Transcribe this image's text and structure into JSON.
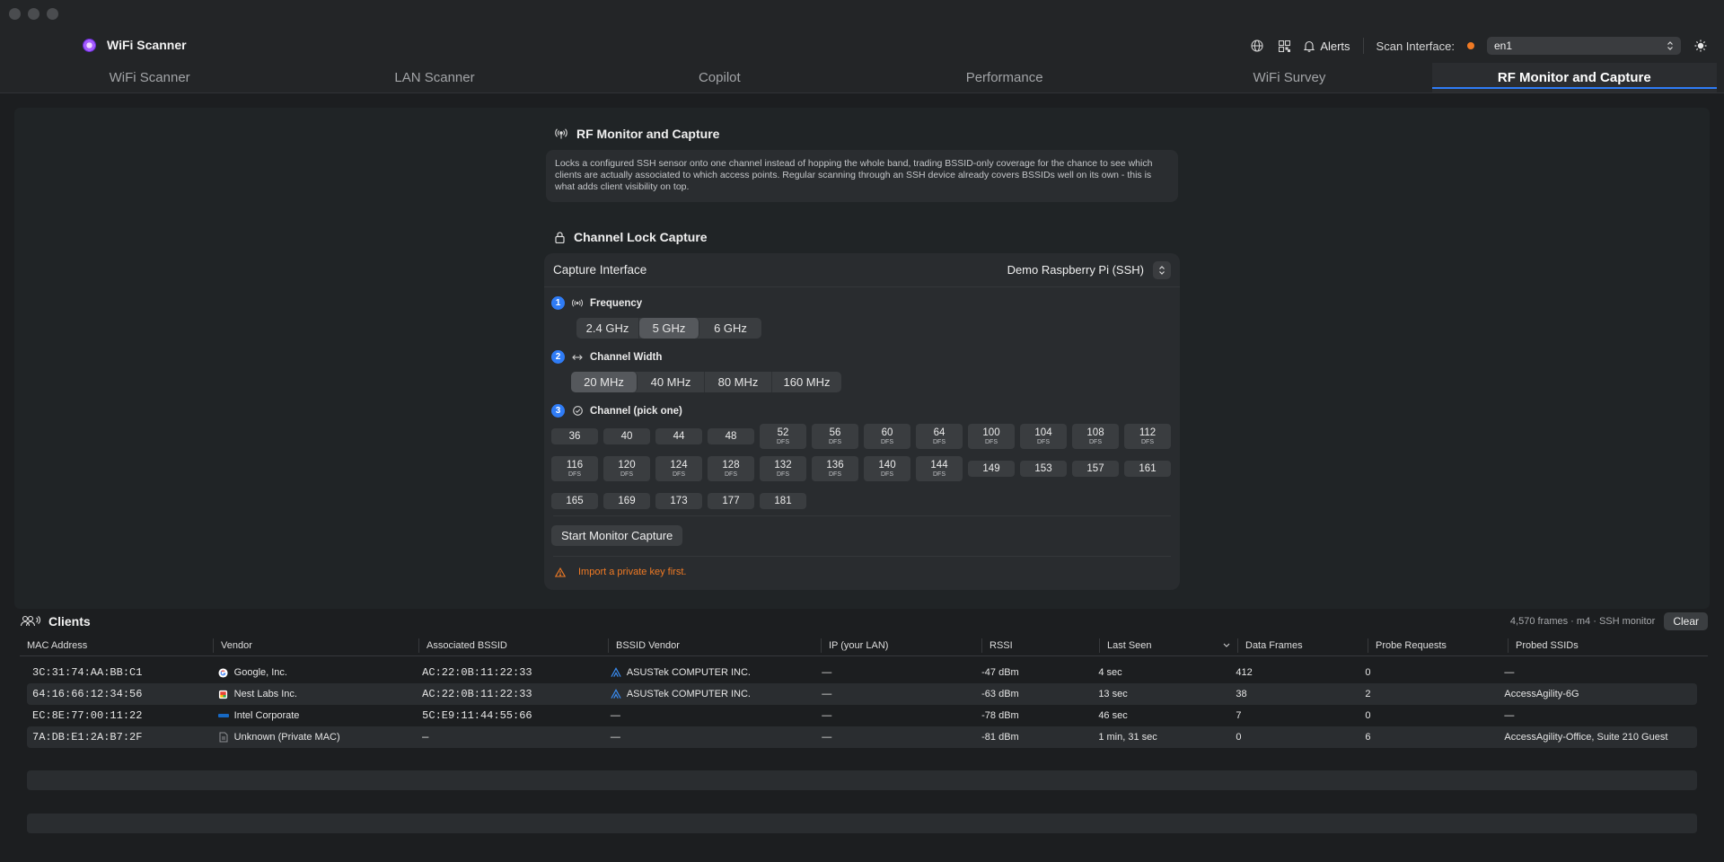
{
  "app": {
    "name": "WiFi Scanner"
  },
  "toolbar": {
    "alerts_label": "Alerts",
    "scan_interface_label": "Scan Interface:",
    "scan_interface_value": "en1",
    "status_color": "#f07a24"
  },
  "tabs": [
    {
      "label": "WiFi Scanner",
      "active": false
    },
    {
      "label": "LAN Scanner",
      "active": false
    },
    {
      "label": "Copilot",
      "active": false
    },
    {
      "label": "Performance",
      "active": false
    },
    {
      "label": "WiFi Survey",
      "active": false
    },
    {
      "label": "RF Monitor and Capture",
      "active": true
    }
  ],
  "rf": {
    "title": "RF Monitor and Capture",
    "description": "Locks a configured SSH sensor onto one channel instead of hopping the whole band, trading BSSID-only coverage for the chance to see which clients are actually associated to which access points. Regular scanning through an SSH device already covers BSSIDs well on its own - this is what adds client visibility on top."
  },
  "lock": {
    "title": "Channel Lock Capture",
    "capture_interface_label": "Capture Interface",
    "capture_interface_value": "Demo Raspberry Pi (SSH)",
    "steps": {
      "frequency": {
        "num": "1",
        "label": "Frequency"
      },
      "width": {
        "num": "2",
        "label": "Channel Width"
      },
      "channel": {
        "num": "3",
        "label": "Channel (pick one)"
      }
    },
    "frequency_options": [
      "2.4 GHz",
      "5 GHz",
      "6 GHz"
    ],
    "frequency_selected": "5 GHz",
    "width_options": [
      "20 MHz",
      "40 MHz",
      "80 MHz",
      "160 MHz"
    ],
    "width_selected": "20 MHz",
    "dfs_label": "DFS",
    "channels": [
      [
        {
          "n": "36",
          "dfs": false
        },
        {
          "n": "40",
          "dfs": false
        },
        {
          "n": "44",
          "dfs": false
        },
        {
          "n": "48",
          "dfs": false
        },
        {
          "n": "52",
          "dfs": true
        },
        {
          "n": "56",
          "dfs": true
        },
        {
          "n": "60",
          "dfs": true
        },
        {
          "n": "64",
          "dfs": true
        },
        {
          "n": "100",
          "dfs": true
        },
        {
          "n": "104",
          "dfs": true
        },
        {
          "n": "108",
          "dfs": true
        },
        {
          "n": "112",
          "dfs": true
        }
      ],
      [
        {
          "n": "116",
          "dfs": true
        },
        {
          "n": "120",
          "dfs": true
        },
        {
          "n": "124",
          "dfs": true
        },
        {
          "n": "128",
          "dfs": true
        },
        {
          "n": "132",
          "dfs": true
        },
        {
          "n": "136",
          "dfs": true
        },
        {
          "n": "140",
          "dfs": true
        },
        {
          "n": "144",
          "dfs": true
        },
        {
          "n": "149",
          "dfs": false
        },
        {
          "n": "153",
          "dfs": false
        },
        {
          "n": "157",
          "dfs": false
        },
        {
          "n": "161",
          "dfs": false
        }
      ],
      [
        {
          "n": "165",
          "dfs": false
        },
        {
          "n": "169",
          "dfs": false
        },
        {
          "n": "173",
          "dfs": false
        },
        {
          "n": "177",
          "dfs": false
        },
        {
          "n": "181",
          "dfs": false
        }
      ]
    ],
    "start_button": "Start Monitor Capture",
    "warning": "Import a private key first."
  },
  "clients": {
    "title": "Clients",
    "summary": "4,570 frames · m4 · SSH monitor",
    "clear_button": "Clear",
    "columns": [
      "MAC Address",
      "Vendor",
      "Associated BSSID",
      "BSSID Vendor",
      "IP (your LAN)",
      "RSSI",
      "Last Seen",
      "Data Frames",
      "Probe Requests",
      "Probed SSIDs"
    ],
    "rows": [
      {
        "mac": "3C:31:74:AA:BB:C1",
        "vendor": "Google, Inc.",
        "vendor_icon": "google-icon",
        "bssid": "AC:22:0B:11:22:33",
        "bssid_vendor": "ASUSTek COMPUTER INC.",
        "bssid_vendor_icon": "asus-icon",
        "ip": "—",
        "rssi": "-47 dBm",
        "last_seen": "4 sec",
        "data_frames": "412",
        "probe_requests": "0",
        "probed_ssids": "—"
      },
      {
        "mac": "64:16:66:12:34:56",
        "vendor": "Nest Labs Inc.",
        "vendor_icon": "nest-icon",
        "bssid": "AC:22:0B:11:22:33",
        "bssid_vendor": "ASUSTek COMPUTER INC.",
        "bssid_vendor_icon": "asus-icon",
        "ip": "—",
        "rssi": "-63 dBm",
        "last_seen": "13 sec",
        "data_frames": "38",
        "probe_requests": "2",
        "probed_ssids": "AccessAgility-6G"
      },
      {
        "mac": "EC:8E:77:00:11:22",
        "vendor": "Intel Corporate",
        "vendor_icon": "intel-icon",
        "bssid": "5C:E9:11:44:55:66",
        "bssid_vendor": "—",
        "bssid_vendor_icon": "",
        "ip": "—",
        "rssi": "-78 dBm",
        "last_seen": "46 sec",
        "data_frames": "7",
        "probe_requests": "0",
        "probed_ssids": "—"
      },
      {
        "mac": "7A:DB:E1:2A:B7:2F",
        "vendor": "Unknown (Private MAC)",
        "vendor_icon": "document-icon",
        "bssid": "—",
        "bssid_vendor": "—",
        "bssid_vendor_icon": "",
        "ip": "—",
        "rssi": "-81 dBm",
        "last_seen": "1 min, 31 sec",
        "data_frames": "0",
        "probe_requests": "6",
        "probed_ssids": "AccessAgility-Office, Suite 210 Guest"
      }
    ]
  }
}
